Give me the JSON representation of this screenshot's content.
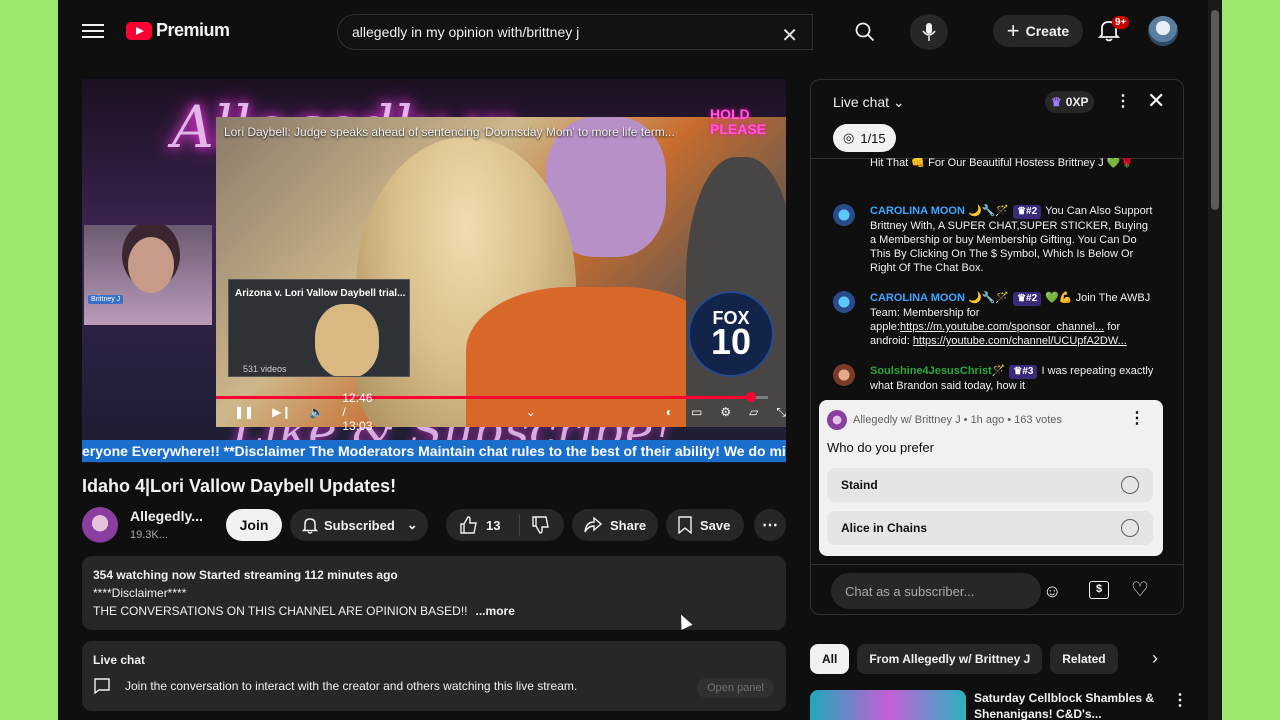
{
  "header": {
    "brand": "Premium",
    "search_value": "allegedly in my opinion with/brittney j",
    "create_label": "Create",
    "notifications_count": "9+"
  },
  "video": {
    "overlay_title": "Lori Daybell: Judge speaks ahead of sentencing 'Doomsday Mom' to more life term...",
    "hold_text": "HOLD\nPLEASE",
    "fox_top": "FOX",
    "fox_num": "10",
    "mini_title": "Arizona v. Lori Vallow Daybell trial...",
    "mini_count": "531 videos",
    "webcam_tag": "Brittney J",
    "time": "12:46 / 13:03",
    "progress": 0.97,
    "ticker": "eryone Everywhere!! **Disclaimer The Moderators Maintain chat rules to the best of their ability! We do mi"
  },
  "title": "Idaho 4|Lori Vallow Daybell Updates!",
  "channel": {
    "name": "Allegedly...",
    "subs": "19.3K...",
    "join_label": "Join",
    "subscribed_label": "Subscribed"
  },
  "actions": {
    "likes": "13",
    "share_label": "Share",
    "save_label": "Save"
  },
  "description": {
    "stats": "354 watching now  Started streaming 112 minutes ago",
    "line1": "****Disclaimer****",
    "line2": "THE CONVERSATIONS ON THIS CHANNEL ARE OPINION BASED!!",
    "more": "...more"
  },
  "live_chat_box": {
    "heading": "Live chat",
    "text": "Join the conversation to interact with the creator and others watching this live stream.",
    "open_panel": "Open panel"
  },
  "chat": {
    "title": "Live chat",
    "xp": "0XP",
    "counter": "1/15",
    "messages": [
      {
        "author": "",
        "text": "Hit That 👊 For Our Beautiful Hostess Brittney J 💚🌹"
      },
      {
        "author": "CAROLINA MOON 🌙🔧🪄",
        "badge": "#2",
        "text": "You Can Also Support Brittney With, A SUPER CHAT,SUPER STICKER, Buying a Membership or buy Membership Gifting. You Can Do This By Clicking On The $ Symbol, Which Is Below Or Right Of The Chat Box."
      },
      {
        "author": "CAROLINA MOON 🌙🔧🪄",
        "badge": "#2",
        "text_pre": "💚💪 Join The AWBJ Team: Membership for apple:",
        "link1": "https://m.youtube.com/sponsor_channel...",
        "text_mid": " for android: ",
        "link2": "https://youtube.com/channel/UCUpfA2DW..."
      },
      {
        "author": "Soulshine4JesusChrist🪄",
        "badge": "#3",
        "text": "I was repeating exactly what Brandon said today, how it"
      }
    ],
    "poll": {
      "meta": "Allegedly w/ Brittney J • 1h ago • 163 votes",
      "question": "Who do you prefer",
      "options": [
        "Staind",
        "Alice in Chains"
      ]
    },
    "input_placeholder": "Chat as a subscriber..."
  },
  "chips": [
    "All",
    "From Allegedly w/ Brittney J",
    "Related"
  ],
  "recommendation": {
    "title": "Saturday Cellblock Shambles & Shenanigans! C&D's..."
  },
  "colors": {
    "accent_red": "#ff0033",
    "background": "#0f0f0f",
    "ticker_blue": "#1a6fcc"
  }
}
